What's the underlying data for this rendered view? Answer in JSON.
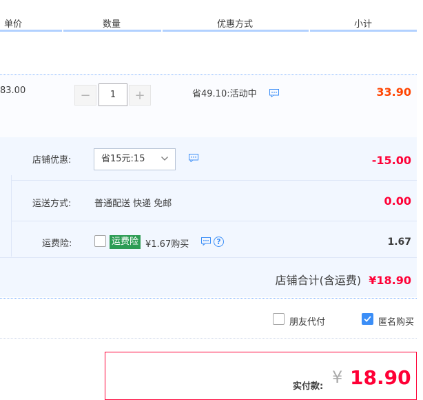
{
  "header": {
    "col_unit_price": "单价",
    "col_quantity": "数量",
    "col_discount": "优惠方式",
    "col_subtotal": "小计"
  },
  "item": {
    "unit_price": "83.00",
    "quantity": "1",
    "minus_label": "−",
    "plus_label": "+",
    "discount_text": "省49.10:活动中",
    "subtotal": "33.90"
  },
  "shop": {
    "coupon_label": "店铺优惠:",
    "coupon_selected": "省15元:15",
    "coupon_amount": "-15.00",
    "shipping_label": "运送方式:",
    "shipping_value": "普通配送 快递 免邮",
    "shipping_amount": "0.00",
    "insurance_label": "运费险:",
    "insurance_badge": "运费险",
    "insurance_text": "¥1.67购买",
    "insurance_amount": "1.67",
    "total_label": "店铺合计(含运费)",
    "total_amount": "¥18.90",
    "help_glyph": "?"
  },
  "options": {
    "friend_pay_label": "朋友代付",
    "friend_pay_checked": false,
    "anonymous_label": "匿名购买",
    "anonymous_checked": true
  },
  "payment": {
    "label": "实付款:",
    "currency": "¥",
    "amount": "18.90"
  },
  "colors": {
    "accent_red": "#ff0036",
    "price_red": "#f40",
    "header_line": "#b2d1ff",
    "checkbox_blue": "#3b8ef7",
    "badge_green": "#2d9c54"
  }
}
